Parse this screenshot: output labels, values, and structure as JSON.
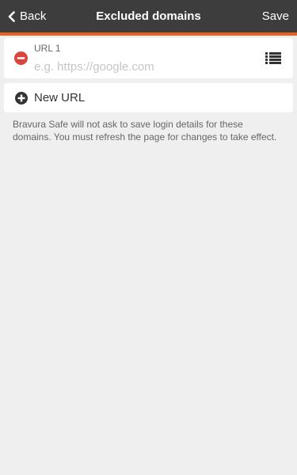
{
  "header": {
    "back_label": "Back",
    "title": "Excluded domains",
    "save_label": "Save",
    "accent_color": "#e8601c",
    "background_color": "#3d3d3d"
  },
  "urls": [
    {
      "label": "URL 1",
      "value": "",
      "placeholder": "e.g. https://google.com",
      "remove_icon": "remove-circle-icon",
      "list_icon": "list-icon"
    }
  ],
  "new_url": {
    "label": "New URL",
    "icon": "add-circle-icon"
  },
  "info_text": "Bravura Safe will not ask to save login details for these domains. You must refresh the page for changes to take effect."
}
